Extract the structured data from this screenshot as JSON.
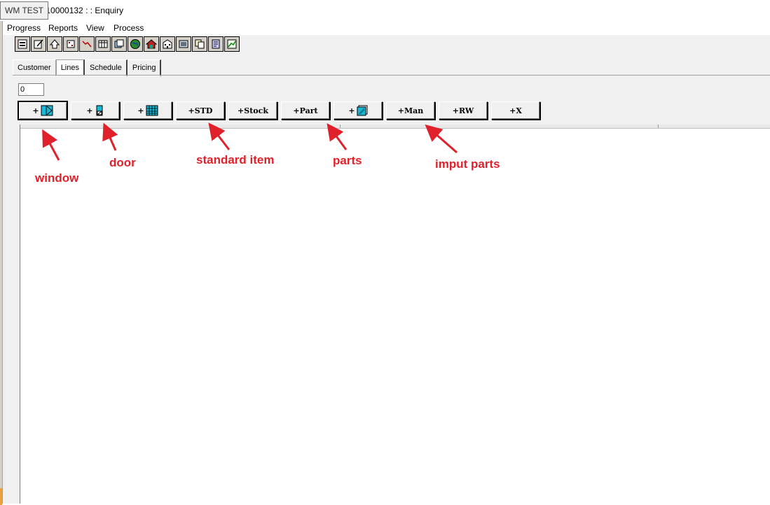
{
  "window": {
    "badge": "WM TEST",
    "title": "te 10000132 : : Enquiry"
  },
  "menu": [
    "Progress",
    "Reports",
    "View",
    "Process"
  ],
  "toolbar_icons": [
    "properties-icon",
    "edit-icon",
    "upload-icon",
    "grid-dots-icon",
    "chart-icon",
    "table-icon",
    "layers-icon",
    "globe-icon",
    "house-icon",
    "building-icon",
    "list-icon",
    "copy-icon",
    "document-icon",
    "graph-icon"
  ],
  "tabs": [
    "Customer",
    "Lines",
    "Schedule",
    "Pricing"
  ],
  "active_tab": "Lines",
  "quantity_value": "0",
  "add_buttons": [
    {
      "label": "+",
      "icon": "window-icon"
    },
    {
      "label": "+",
      "icon": "door-icon"
    },
    {
      "label": "+",
      "icon": "grid-icon"
    },
    {
      "label": "+STD",
      "icon": ""
    },
    {
      "label": "+Stock",
      "icon": ""
    },
    {
      "label": "+Part",
      "icon": ""
    },
    {
      "label": "+",
      "icon": "panel-icon"
    },
    {
      "label": "+Man",
      "icon": ""
    },
    {
      "label": "+RW",
      "icon": ""
    },
    {
      "label": "+X",
      "icon": ""
    }
  ],
  "annotations": {
    "window": "window",
    "door": "door",
    "standard_item": "standard item",
    "parts": "parts",
    "imput_parts": "imput parts"
  },
  "colors": {
    "annotation": "#e0202a",
    "icon_cyan": "#19b9d6",
    "chrome": "#f0f0f0"
  }
}
